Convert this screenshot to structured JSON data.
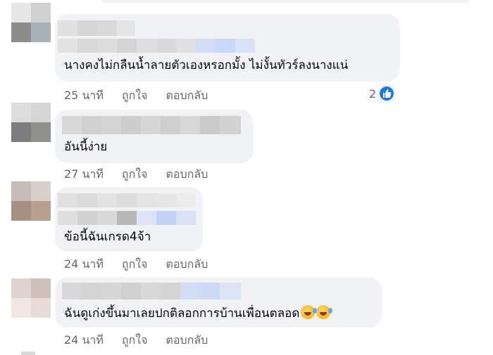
{
  "comments": [
    {
      "text": "นางคงไม่กลืนน้ำลายตัวเองหรอกมั้ง ไม่งั้นทัวร์ลงนางแน่",
      "time": "25 นาที",
      "like": "ถูกใจ",
      "reply": "ตอบกลับ",
      "reaction_count": "2",
      "reaction_icon": "like-icon"
    },
    {
      "text": "อันนี้ง่าย",
      "time": "27 นาที",
      "like": "ถูกใจ",
      "reply": "ตอบกลับ"
    },
    {
      "text": "ข้อนี้ฉันเกรด4จ้า",
      "time": "24 นาที",
      "like": "ถูกใจ",
      "reply": "ตอบกลับ"
    },
    {
      "text": "ฉันดูเก่งขึ้นมาเลยปกติลอกการบ้านเพื่อนตลอด",
      "emojis": [
        "rolling-on-floor-laughing-emoji",
        "rolling-on-floor-laughing-emoji"
      ],
      "time": "24 นาที",
      "like": "ถูกใจ",
      "reply": "ตอบกลับ"
    }
  ],
  "colors": {
    "bubble": "#f0f2f5",
    "meta_text": "#65676b",
    "like_blue": "#1877f2"
  }
}
